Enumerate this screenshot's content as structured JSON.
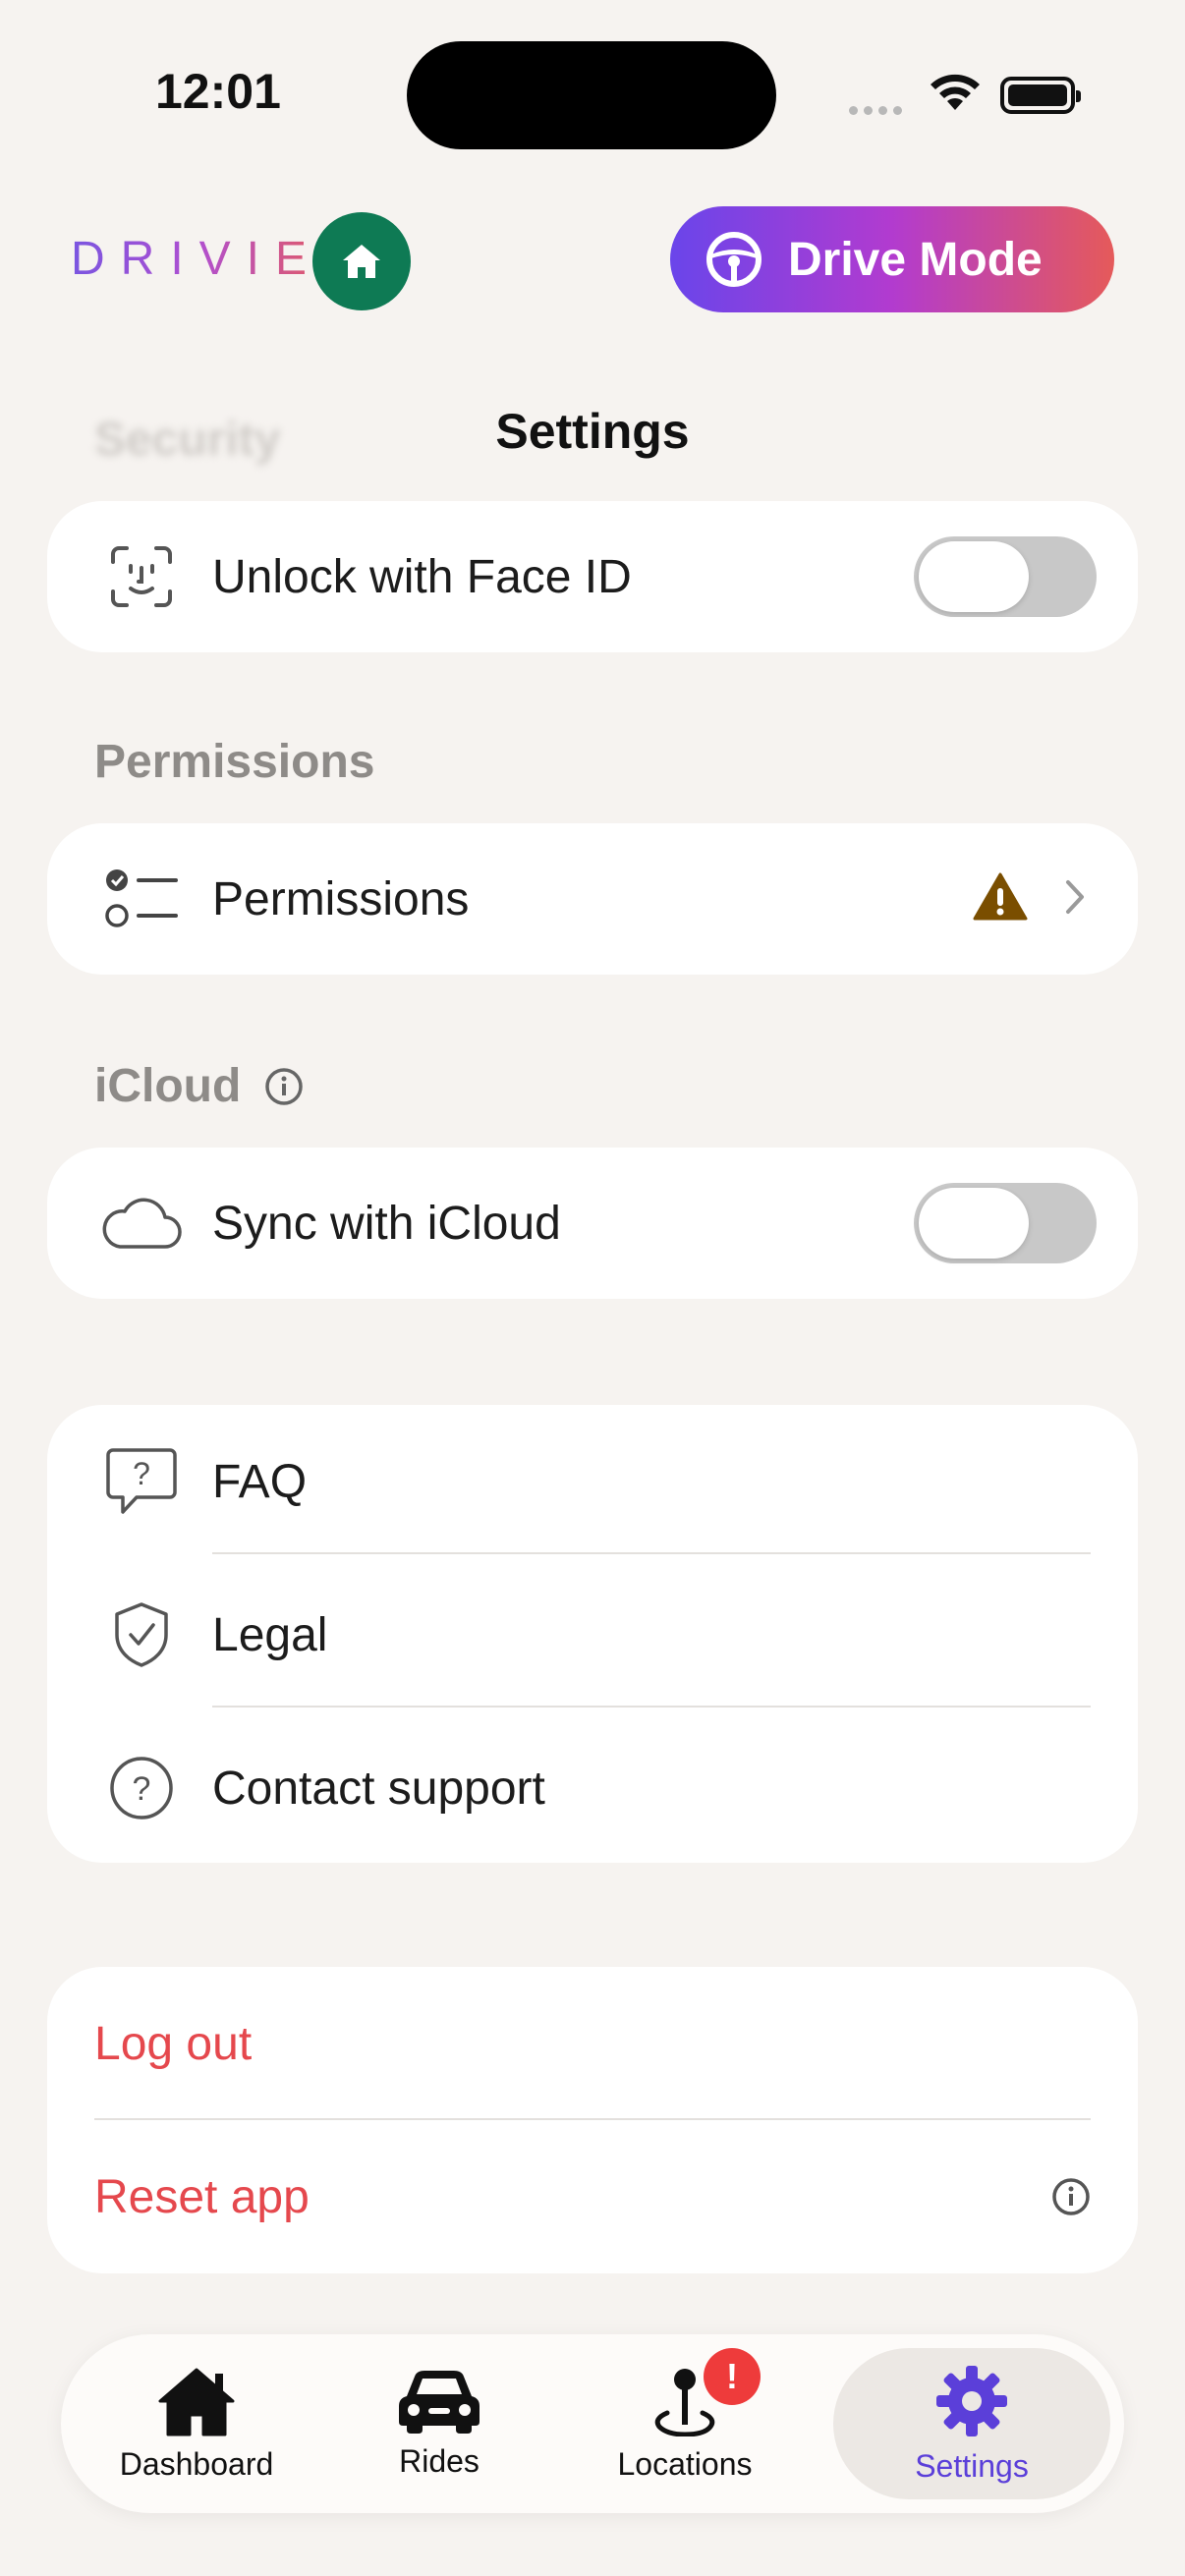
{
  "status_bar": {
    "time": "12:01"
  },
  "header": {
    "brand": "DRIVIE",
    "drive_mode_label": "Drive Mode",
    "page_title": "Settings",
    "ghost_section": "Security"
  },
  "security": {
    "face_id_label": "Unlock with Face ID",
    "face_id_enabled": false
  },
  "permissions": {
    "section_title": "Permissions",
    "row_label": "Permissions"
  },
  "icloud": {
    "section_title": "iCloud",
    "sync_label": "Sync with iCloud",
    "sync_enabled": false
  },
  "support": {
    "faq_label": "FAQ",
    "legal_label": "Legal",
    "contact_label": "Contact support"
  },
  "account": {
    "logout_label": "Log out",
    "reset_label": "Reset app"
  },
  "tabs": [
    {
      "label": "Dashboard",
      "icon": "house-icon"
    },
    {
      "label": "Rides",
      "icon": "car-icon"
    },
    {
      "label": "Locations",
      "icon": "map-pin-icon",
      "badge": "!"
    },
    {
      "label": "Settings",
      "icon": "gear-icon",
      "active": true
    }
  ],
  "colors": {
    "accent": "#5b3fd9",
    "destructive": "#e5484d",
    "home_button": "#0e7a54",
    "warning": "#7a4e00"
  }
}
